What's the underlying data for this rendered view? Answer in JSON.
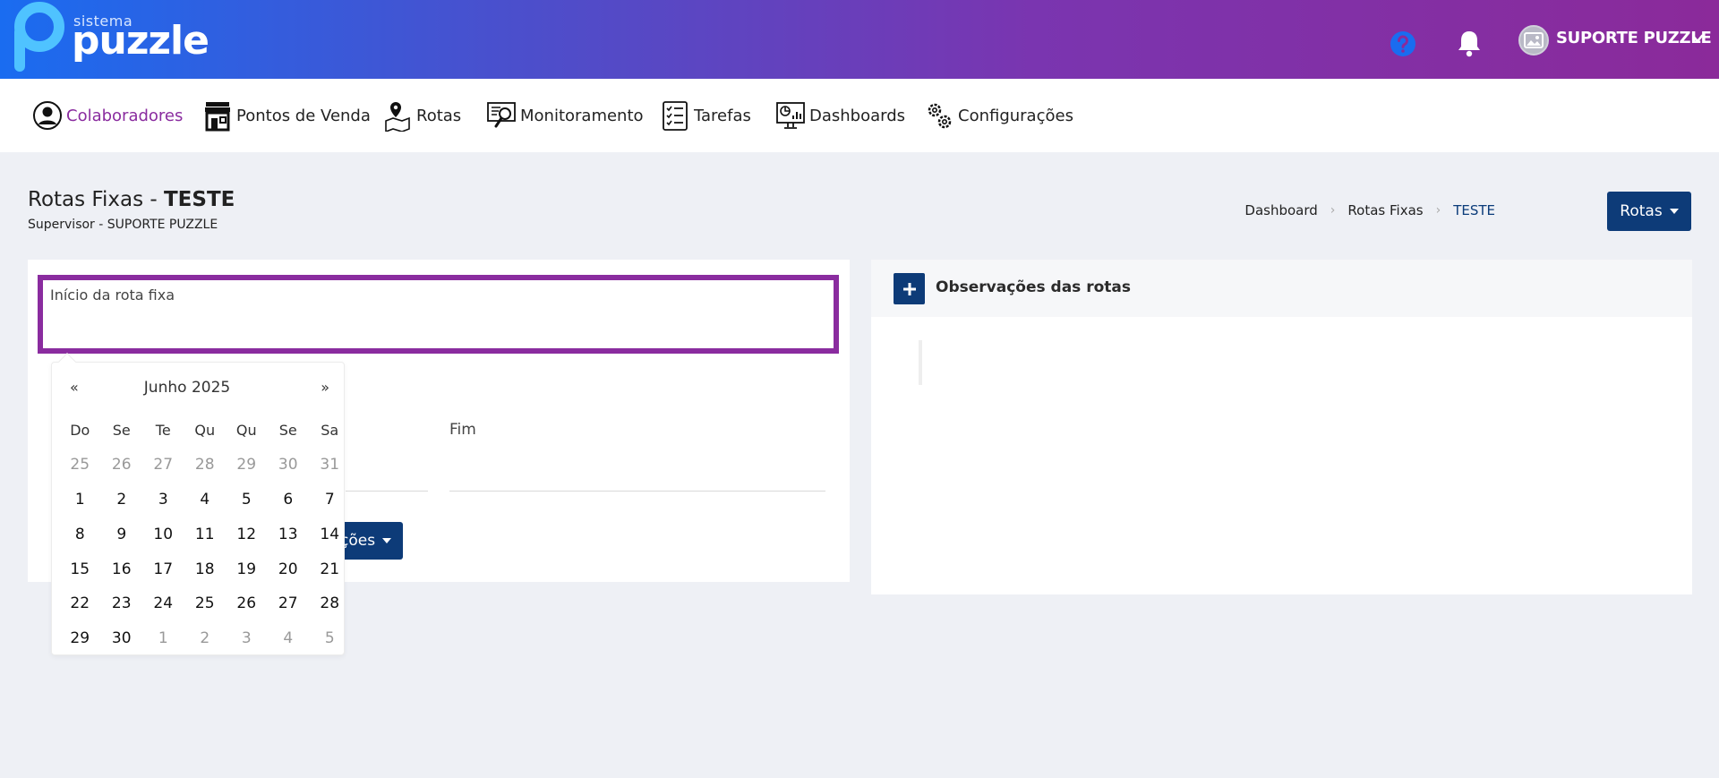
{
  "header": {
    "logo_small": "sistema",
    "logo_big": "puzzle",
    "user_name": "SUPORTE PUZZLE",
    "icons": [
      "help-icon",
      "bell-icon",
      "avatar-image-icon",
      "chevron-down-icon"
    ],
    "gradient_colors": [
      "#1a6cf0",
      "#8b2a9a"
    ]
  },
  "nav": {
    "items": [
      {
        "label": "Colaboradores",
        "icon": "user-circle-icon",
        "active": true
      },
      {
        "label": "Pontos de Venda",
        "icon": "store-icon",
        "active": false
      },
      {
        "label": "Rotas",
        "icon": "map-pin-icon",
        "active": false
      },
      {
        "label": "Monitoramento",
        "icon": "monitor-search-icon",
        "active": false
      },
      {
        "label": "Tarefas",
        "icon": "checklist-icon",
        "active": false
      },
      {
        "label": "Dashboards",
        "icon": "dashboard-icon",
        "active": false
      },
      {
        "label": "Configurações",
        "icon": "gears-icon",
        "active": false
      }
    ],
    "active_color": "#8a2c9f"
  },
  "page": {
    "title_prefix": "Rotas Fixas - ",
    "title_bold": "TESTE",
    "subtitle": "Supervisor - SUPORTE PUZZLE",
    "breadcrumb": [
      "Dashboard",
      "Rotas Fixas",
      "TESTE"
    ],
    "rotas_button": "Rotas"
  },
  "form": {
    "start_label": "Início da rota fixa",
    "end_label": "Fim",
    "actions_button": "ções",
    "highlight_color": "#8a2c9f"
  },
  "datepicker": {
    "prev": "«",
    "next": "»",
    "title": "Junho 2025",
    "weekdays": [
      "Do",
      "Se",
      "Te",
      "Qu",
      "Qu",
      "Se",
      "Sa"
    ],
    "days": [
      {
        "d": "25",
        "muted": true
      },
      {
        "d": "26",
        "muted": true
      },
      {
        "d": "27",
        "muted": true
      },
      {
        "d": "28",
        "muted": true
      },
      {
        "d": "29",
        "muted": true
      },
      {
        "d": "30",
        "muted": true
      },
      {
        "d": "31",
        "muted": true
      },
      {
        "d": "1"
      },
      {
        "d": "2"
      },
      {
        "d": "3"
      },
      {
        "d": "4"
      },
      {
        "d": "5"
      },
      {
        "d": "6"
      },
      {
        "d": "7"
      },
      {
        "d": "8"
      },
      {
        "d": "9"
      },
      {
        "d": "10"
      },
      {
        "d": "11"
      },
      {
        "d": "12"
      },
      {
        "d": "13"
      },
      {
        "d": "14"
      },
      {
        "d": "15"
      },
      {
        "d": "16"
      },
      {
        "d": "17"
      },
      {
        "d": "18"
      },
      {
        "d": "19"
      },
      {
        "d": "20"
      },
      {
        "d": "21"
      },
      {
        "d": "22"
      },
      {
        "d": "23"
      },
      {
        "d": "24"
      },
      {
        "d": "25"
      },
      {
        "d": "26"
      },
      {
        "d": "27"
      },
      {
        "d": "28"
      },
      {
        "d": "29"
      },
      {
        "d": "30"
      },
      {
        "d": "1",
        "muted": true
      },
      {
        "d": "2",
        "muted": true
      },
      {
        "d": "3",
        "muted": true
      },
      {
        "d": "4",
        "muted": true
      },
      {
        "d": "5",
        "muted": true
      }
    ]
  },
  "notes": {
    "title": "Observações das rotas",
    "add_icon": "plus-icon"
  }
}
